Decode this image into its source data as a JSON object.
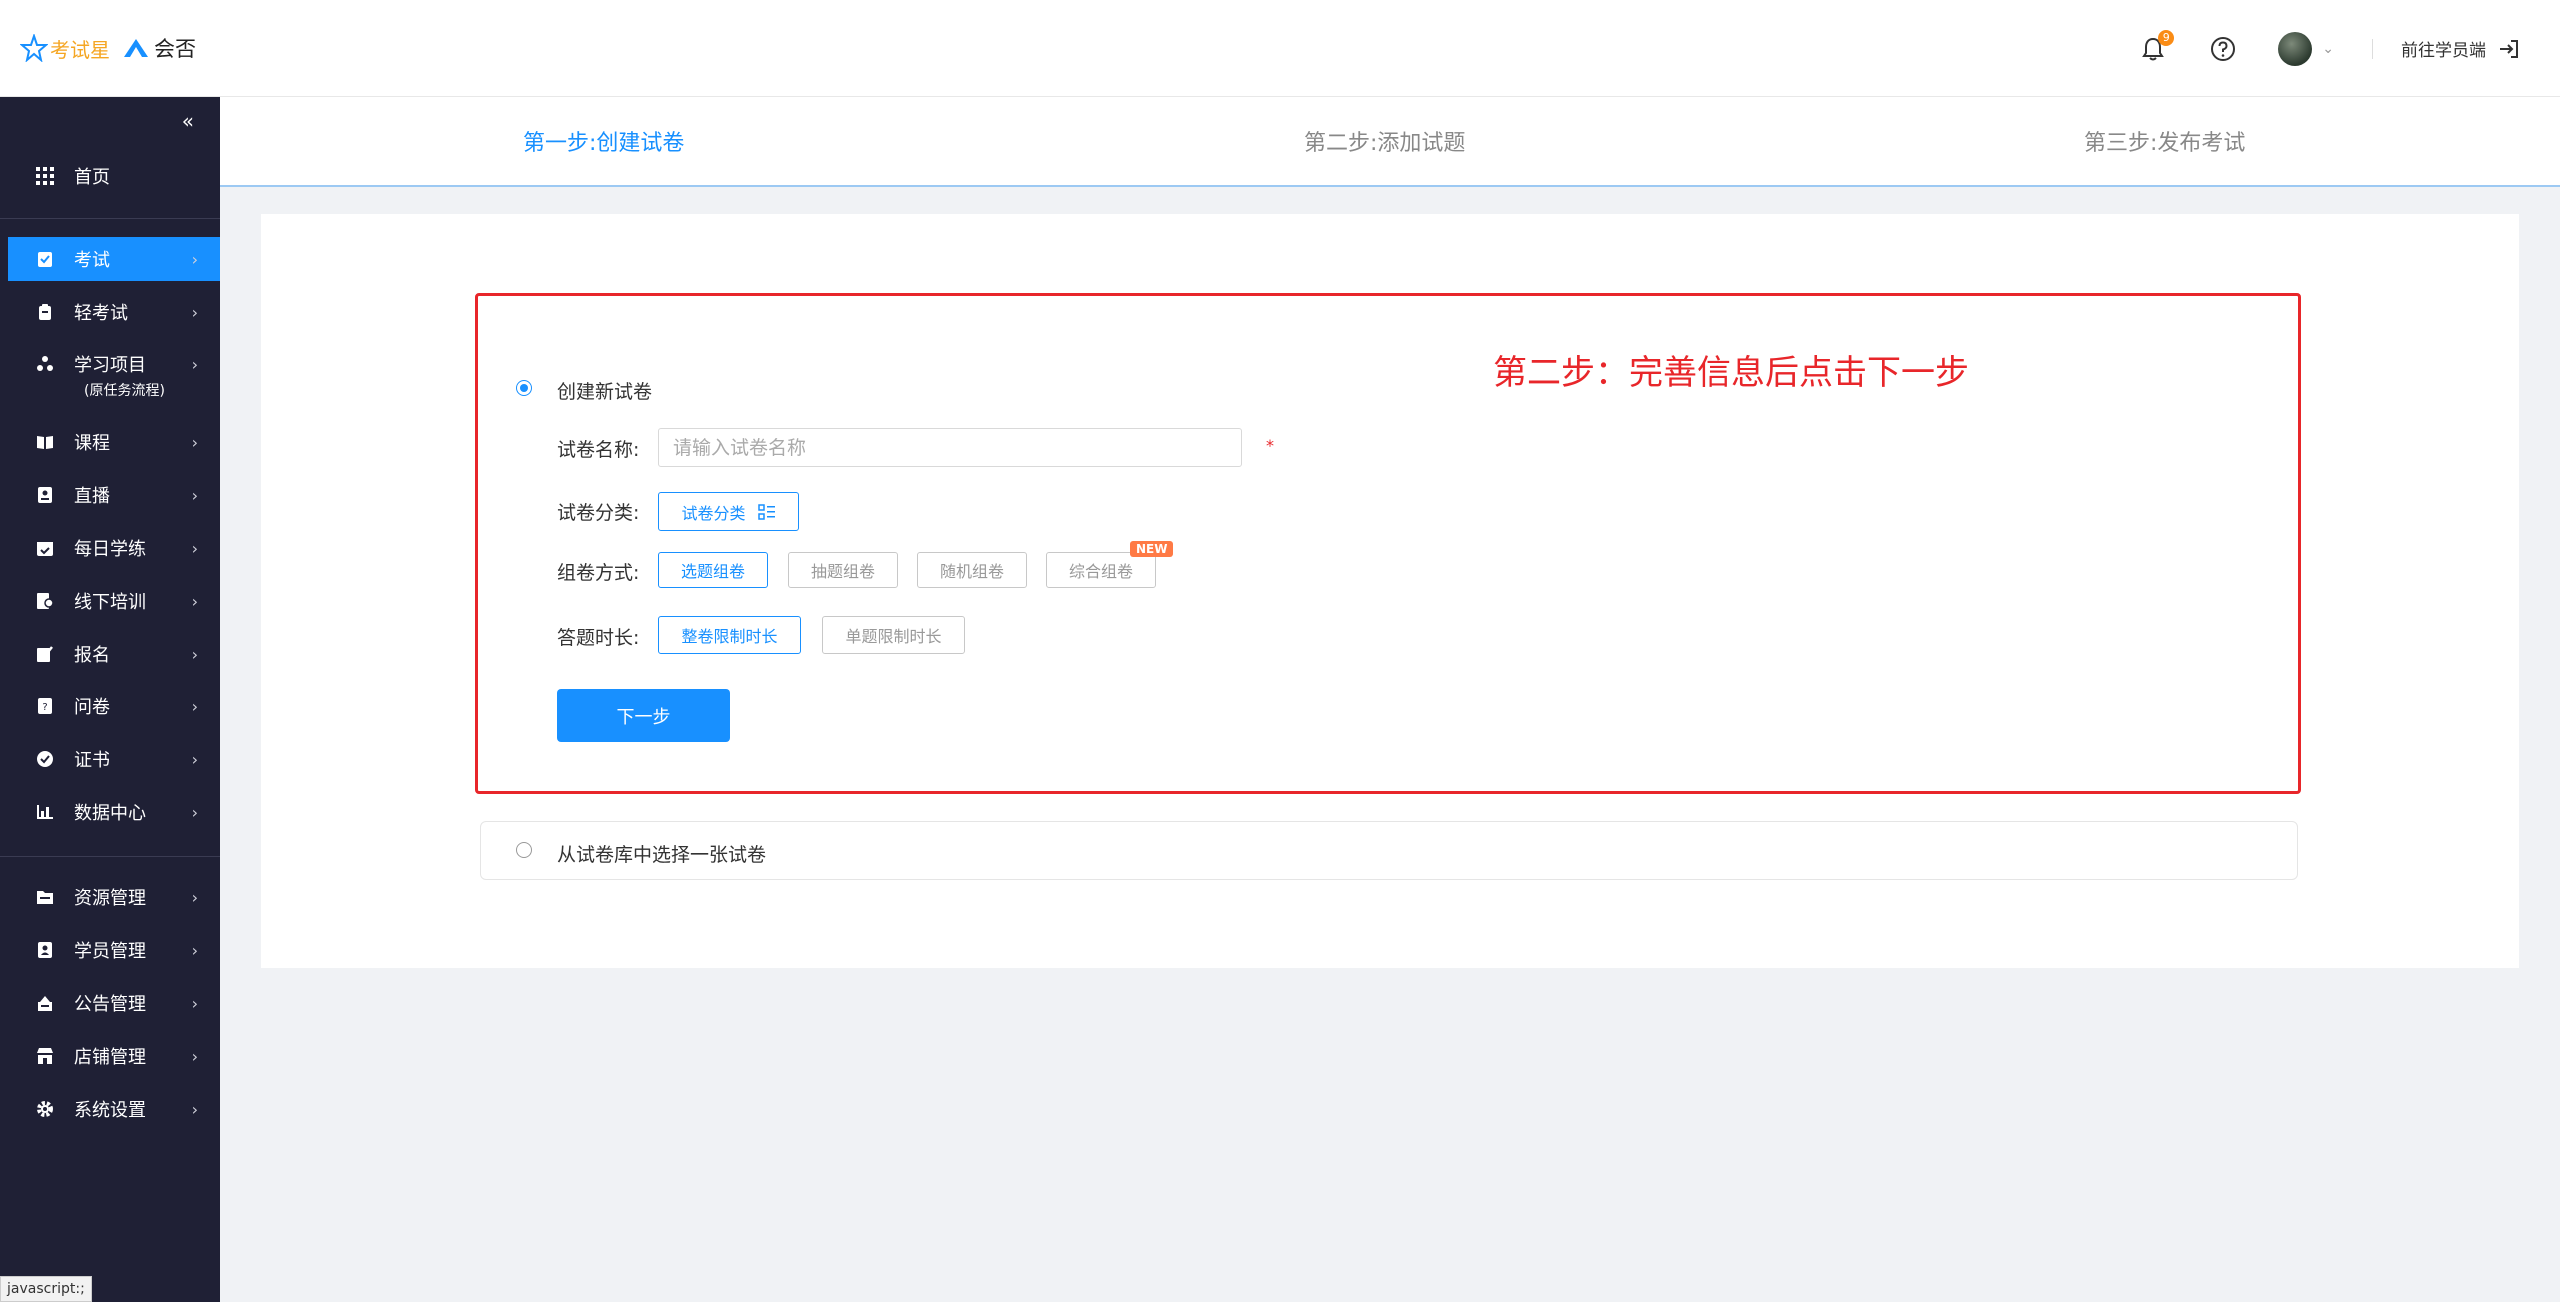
{
  "header": {
    "brand_primary": "考试星",
    "brand_secondary": "会否",
    "notification_count": "9",
    "goto_label": "前往学员端"
  },
  "sidebar": {
    "items": [
      {
        "label": "首页",
        "icon": "grid-icon"
      },
      {
        "label": "考试",
        "icon": "exam-icon",
        "active": true
      },
      {
        "label": "轻考试",
        "icon": "light-exam-icon"
      },
      {
        "label": "学习项目",
        "sublabel": "(原任务流程)",
        "icon": "project-icon"
      },
      {
        "label": "课程",
        "icon": "book-icon"
      },
      {
        "label": "直播",
        "icon": "live-icon"
      },
      {
        "label": "每日学练",
        "icon": "calendar-icon"
      },
      {
        "label": "线下培训",
        "icon": "training-icon"
      },
      {
        "label": "报名",
        "icon": "signup-icon"
      },
      {
        "label": "问卷",
        "icon": "survey-icon"
      },
      {
        "label": "证书",
        "icon": "certificate-icon"
      },
      {
        "label": "数据中心",
        "icon": "chart-icon"
      },
      {
        "label": "资源管理",
        "icon": "folder-icon"
      },
      {
        "label": "学员管理",
        "icon": "user-card-icon"
      },
      {
        "label": "公告管理",
        "icon": "notice-icon"
      },
      {
        "label": "店铺管理",
        "icon": "store-icon"
      },
      {
        "label": "系统设置",
        "icon": "gear-icon"
      }
    ],
    "status_text": "javascript:;"
  },
  "steps": [
    {
      "label": "第一步:创建试卷",
      "active": true
    },
    {
      "label": "第二步:添加试题",
      "active": false
    },
    {
      "label": "第三步:发布考试",
      "active": false
    }
  ],
  "annotation": "第二步：完善信息后点击下一步",
  "form": {
    "create_new_label": "创建新试卷",
    "name_label": "试卷名称:",
    "name_placeholder": "请输入试卷名称",
    "name_value": "",
    "required_mark": "*",
    "category_label": "试卷分类:",
    "category_button": "试卷分类",
    "compose_label": "组卷方式:",
    "compose_options": [
      "选题组卷",
      "抽题组卷",
      "随机组卷",
      "综合组卷"
    ],
    "compose_selected": "选题组卷",
    "new_badge": "NEW",
    "duration_label": "答题时长:",
    "duration_options": [
      "整卷限制时长",
      "单题限制时长"
    ],
    "duration_selected": "整卷限制时长",
    "next_button": "下一步"
  },
  "library_option": "从试卷库中选择一张试卷",
  "colors": {
    "primary": "#1890ff",
    "sidebar_bg": "#1f2035",
    "annotation_red": "#e8262a",
    "badge_orange": "#fa8c16"
  }
}
